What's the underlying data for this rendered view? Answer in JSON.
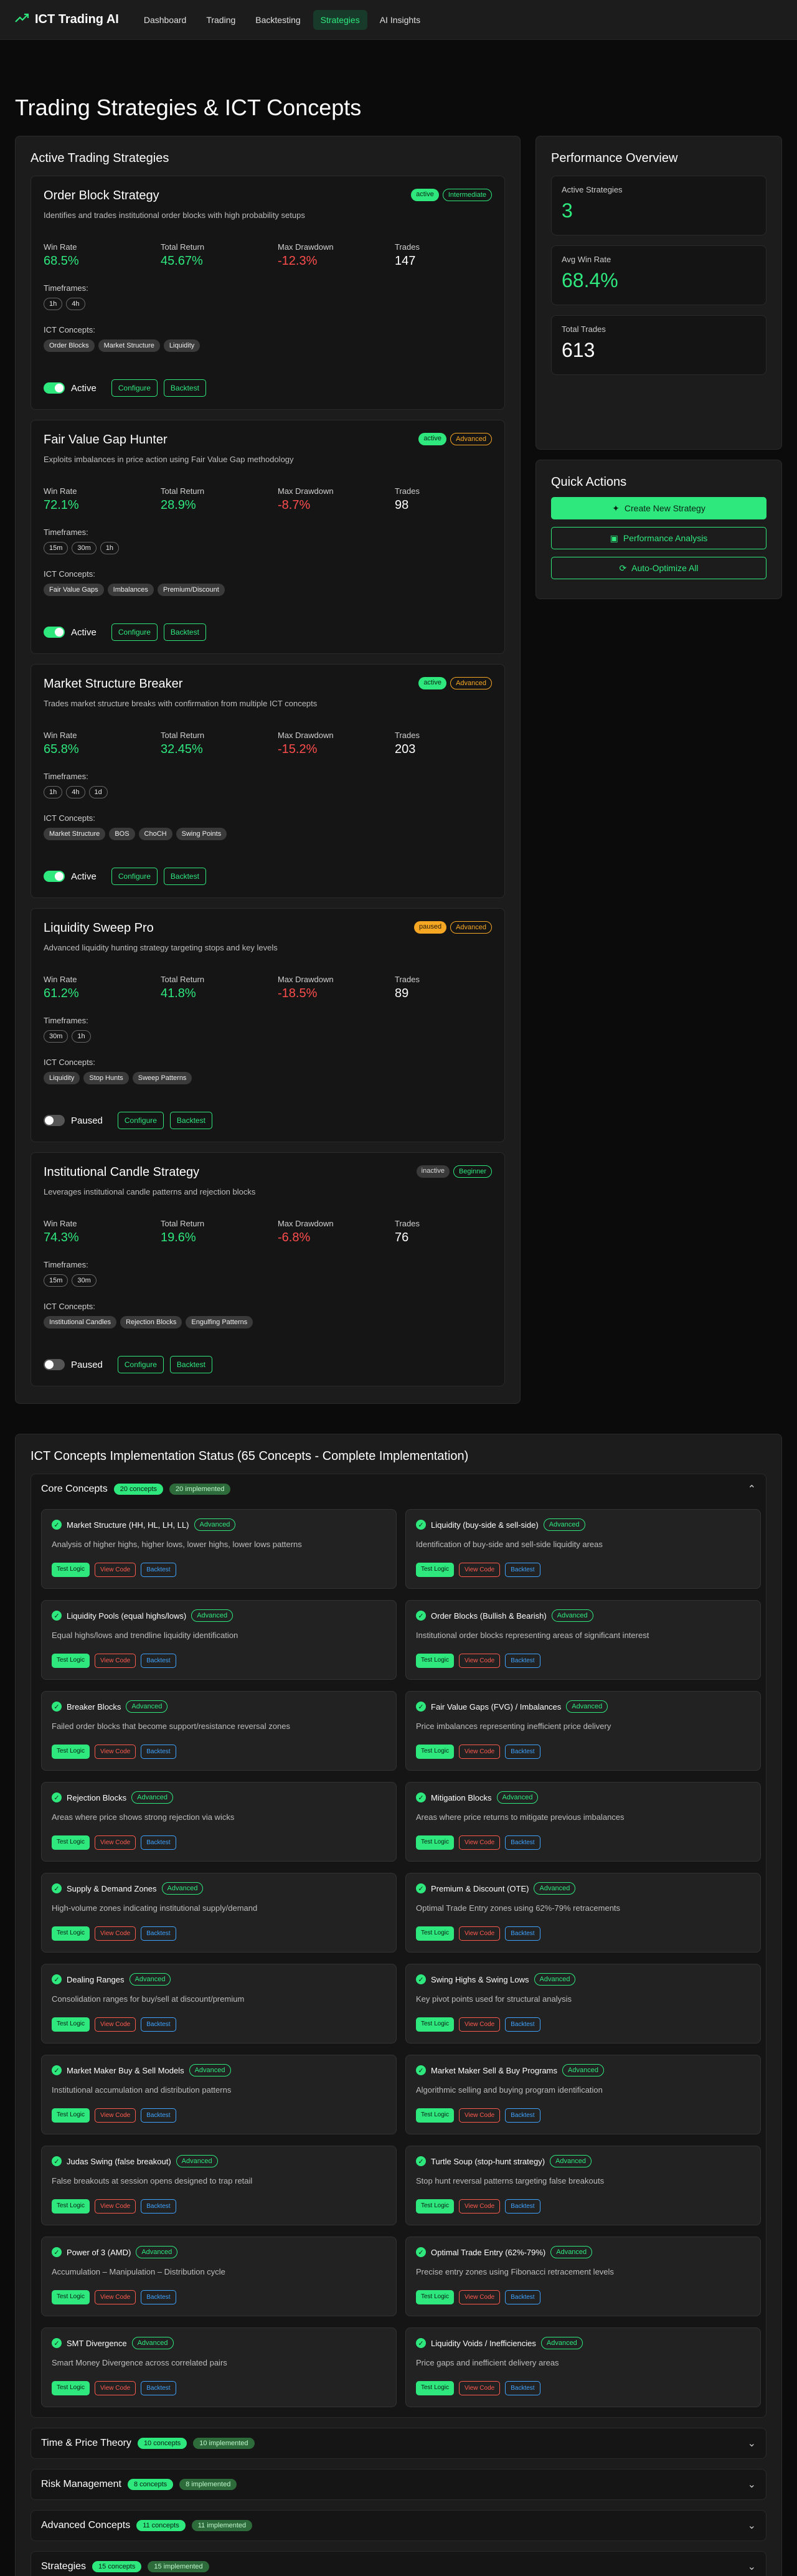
{
  "app": {
    "title": "ICT Trading AI"
  },
  "nav": [
    {
      "label": "Dashboard"
    },
    {
      "label": "Trading"
    },
    {
      "label": "Backtesting"
    },
    {
      "label": "Strategies"
    },
    {
      "label": "AI Insights"
    }
  ],
  "page_title": "Trading Strategies & ICT Concepts",
  "strategies_panel": {
    "title": "Active Trading Strategies",
    "labels": {
      "win_rate": "Win Rate",
      "total_return": "Total Return",
      "max_drawdown": "Max Drawdown",
      "trades": "Trades",
      "timeframes": "Timeframes:",
      "ict_concepts": "ICT Concepts:",
      "configure": "Configure",
      "backtest": "Backtest"
    },
    "items": [
      {
        "name": "Order Block Strategy",
        "status": "active",
        "level": "intermediate",
        "desc": "Identifies and trades institutional order blocks with high probability setups",
        "win_rate": "68.5%",
        "total_return": "45.67%",
        "max_drawdown": "-12.3%",
        "trades": "147",
        "timeframes": [
          "1h",
          "4h"
        ],
        "concepts": [
          "Order Blocks",
          "Market Structure",
          "Liquidity"
        ],
        "state_label": "Active"
      },
      {
        "name": "Fair Value Gap Hunter",
        "status": "active",
        "level": "advanced",
        "desc": "Exploits imbalances in price action using Fair Value Gap methodology",
        "win_rate": "72.1%",
        "total_return": "28.9%",
        "max_drawdown": "-8.7%",
        "trades": "98",
        "timeframes": [
          "15m",
          "30m",
          "1h"
        ],
        "concepts": [
          "Fair Value Gaps",
          "Imbalances",
          "Premium/Discount"
        ],
        "state_label": "Active"
      },
      {
        "name": "Market Structure Breaker",
        "status": "active",
        "level": "advanced",
        "desc": "Trades market structure breaks with confirmation from multiple ICT concepts",
        "win_rate": "65.8%",
        "total_return": "32.45%",
        "max_drawdown": "-15.2%",
        "trades": "203",
        "timeframes": [
          "1h",
          "4h",
          "1d"
        ],
        "concepts": [
          "Market Structure",
          "BOS",
          "ChoCH",
          "Swing Points"
        ],
        "state_label": "Active"
      },
      {
        "name": "Liquidity Sweep Pro",
        "status": "paused",
        "level": "advanced",
        "desc": "Advanced liquidity hunting strategy targeting stops and key levels",
        "win_rate": "61.2%",
        "total_return": "41.8%",
        "max_drawdown": "-18.5%",
        "trades": "89",
        "timeframes": [
          "30m",
          "1h"
        ],
        "concepts": [
          "Liquidity",
          "Stop Hunts",
          "Sweep Patterns"
        ],
        "state_label": "Paused"
      },
      {
        "name": "Institutional Candle Strategy",
        "status": "inactive",
        "level": "beginner",
        "desc": "Leverages institutional candle patterns and rejection blocks",
        "win_rate": "74.3%",
        "total_return": "19.6%",
        "max_drawdown": "-6.8%",
        "trades": "76",
        "timeframes": [
          "15m",
          "30m"
        ],
        "concepts": [
          "Institutional Candles",
          "Rejection Blocks",
          "Engulfing Patterns"
        ],
        "state_label": "Paused"
      }
    ]
  },
  "performance": {
    "title": "Performance Overview",
    "stats": [
      {
        "label": "Active Strategies",
        "value": "3"
      },
      {
        "label": "Avg Win Rate",
        "value": "68.4%"
      },
      {
        "label": "Total Trades",
        "value": "613"
      }
    ]
  },
  "quick_actions": {
    "title": "Quick Actions",
    "create": "Create New Strategy",
    "analysis": "Performance Analysis",
    "optimize": "Auto-Optimize All"
  },
  "concepts": {
    "title": "ICT Concepts Implementation Status (65 Concepts - Complete Implementation)",
    "btn_test": "Test Logic",
    "btn_code": "View Code",
    "btn_backtest": "Backtest",
    "level_label": "Advanced",
    "core": {
      "title": "Core Concepts",
      "count": "20 concepts",
      "impl": "20 implemented",
      "items": [
        {
          "name": "Market Structure (HH, HL, LH, LL)",
          "desc": "Analysis of higher highs, higher lows, lower highs, lower lows patterns"
        },
        {
          "name": "Liquidity (buy-side & sell-side)",
          "desc": "Identification of buy-side and sell-side liquidity areas"
        },
        {
          "name": "Liquidity Pools (equal highs/lows)",
          "desc": "Equal highs/lows and trendline liquidity identification"
        },
        {
          "name": "Order Blocks (Bullish & Bearish)",
          "desc": "Institutional order blocks representing areas of significant interest"
        },
        {
          "name": "Breaker Blocks",
          "desc": "Failed order blocks that become support/resistance reversal zones"
        },
        {
          "name": "Fair Value Gaps (FVG) / Imbalances",
          "desc": "Price imbalances representing inefficient price delivery"
        },
        {
          "name": "Rejection Blocks",
          "desc": "Areas where price shows strong rejection via wicks"
        },
        {
          "name": "Mitigation Blocks",
          "desc": "Areas where price returns to mitigate previous imbalances"
        },
        {
          "name": "Supply & Demand Zones",
          "desc": "High-volume zones indicating institutional supply/demand"
        },
        {
          "name": "Premium & Discount (OTE)",
          "desc": "Optimal Trade Entry zones using 62%-79% retracements"
        },
        {
          "name": "Dealing Ranges",
          "desc": "Consolidation ranges for buy/sell at discount/premium"
        },
        {
          "name": "Swing Highs & Swing Lows",
          "desc": "Key pivot points used for structural analysis"
        },
        {
          "name": "Market Maker Buy & Sell Models",
          "desc": "Institutional accumulation and distribution patterns"
        },
        {
          "name": "Market Maker Sell & Buy Programs",
          "desc": "Algorithmic selling and buying program identification"
        },
        {
          "name": "Judas Swing (false breakout)",
          "desc": "False breakouts at session opens designed to trap retail"
        },
        {
          "name": "Turtle Soup (stop-hunt strategy)",
          "desc": "Stop hunt reversal patterns targeting false breakouts"
        },
        {
          "name": "Power of 3 (AMD)",
          "desc": "Accumulation – Manipulation – Distribution cycle"
        },
        {
          "name": "Optimal Trade Entry (62%-79%)",
          "desc": "Precise entry zones using Fibonacci retracement levels"
        },
        {
          "name": "SMT Divergence",
          "desc": "Smart Money Divergence across correlated pairs"
        },
        {
          "name": "Liquidity Voids / Inefficiencies",
          "desc": "Price gaps and inefficient delivery areas"
        }
      ]
    },
    "collapsed": [
      {
        "title": "Time & Price Theory",
        "count": "10 concepts",
        "impl": "10 implemented"
      },
      {
        "title": "Risk Management",
        "count": "8 concepts",
        "impl": "8 implemented"
      },
      {
        "title": "Advanced Concepts",
        "count": "11 concepts",
        "impl": "11 implemented"
      },
      {
        "title": "Strategies",
        "count": "15 concepts",
        "impl": "15 implemented"
      }
    ]
  },
  "colors": {
    "accent": "#2ee87e",
    "negative": "#ff4d4d",
    "warning": "#f5a623",
    "info": "#3fa3ff"
  }
}
